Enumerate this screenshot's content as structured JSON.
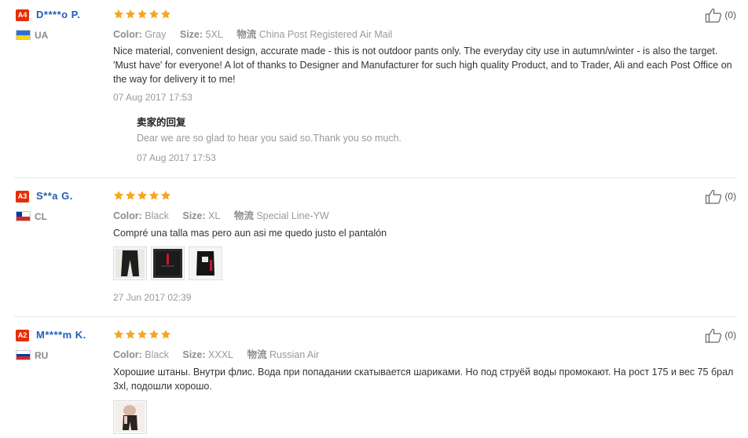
{
  "labels": {
    "color": "Color:",
    "size": "Size:",
    "shipping": "物流",
    "seller_reply": "卖家的回复"
  },
  "reviews": [
    {
      "badge": "A4",
      "user": "D****o P.",
      "country": "UA",
      "flag_colors": [
        "#2f6fd6",
        "#ffd500"
      ],
      "rating": 5,
      "color": "Gray",
      "size": "5XL",
      "shipping": "China Post Registered Air Mail",
      "text": "Nice material, convenient design, accurate made - this is not outdoor pants only. The everyday city use in autumn/winter - is also the target. 'Must have' for everyone! A lot of thanks to Designer and Manufacturer for such high quality Product, and to Trader, Ali and each Post Office on the way for delivery it to me!",
      "date": "07 Aug 2017 17:53",
      "reply": {
        "text": "Dear we are so glad to hear you said so.Thank you so much.",
        "date": "07 Aug 2017 17:53"
      },
      "helpful": "(0)",
      "photos": []
    },
    {
      "badge": "A3",
      "user": "S**a G.",
      "country": "CL",
      "flag_colors": [
        "#ffffff",
        "#d52b1e"
      ],
      "rating": 5,
      "color": "Black",
      "size": "XL",
      "shipping": "Special Line-YW",
      "text": "Compré una talla mas pero aun asi me quedo justo el pantalón",
      "date": "27 Jun 2017 02:39",
      "helpful": "(0)",
      "photos": [
        "black-pants-photo-1",
        "black-pants-photo-2",
        "black-pants-photo-3"
      ]
    },
    {
      "badge": "A2",
      "user": "M****m K.",
      "country": "RU",
      "flag_colors": [
        "#ffffff",
        "#0039a6",
        "#d52b1e"
      ],
      "rating": 5,
      "color": "Black",
      "size": "XXXL",
      "shipping": "Russian Air",
      "text": "Хорошие штаны. Внутри флис. Вода при попадании скатывается шариками. Но под струёй воды промокают. На рост 175 и вес 75 брал 3xl, подошли хорошо.",
      "helpful": "(0)",
      "photos": [
        "worn-pants-photo-1"
      ]
    }
  ],
  "colors": {
    "star": "#f5a623",
    "badge": "#e62e04",
    "username": "#1f5fb6",
    "divider": "#e6e6e6"
  }
}
